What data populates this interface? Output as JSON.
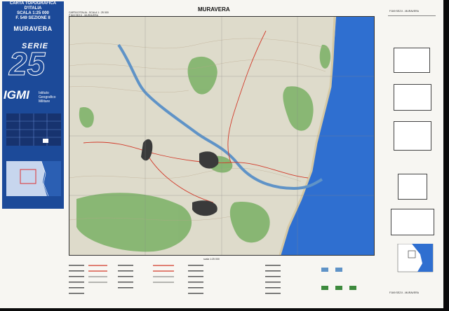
{
  "cover": {
    "title_line1": "CARTA TOPOGRAFICA D'ITALIA",
    "title_line2": "SCALA 1:25 000",
    "title_line3": "F. 549 SEZIONE II",
    "sheet_name": "MURAVERA",
    "serie_label": "SERIE",
    "serie_number": "25",
    "publisher_logo": "IGMI",
    "publisher_name": "Istituto Geografico Militare"
  },
  "map": {
    "title": "MURAVERA",
    "header_line1": "CARTA D'ITALIA - SCALA 1 : 25 000",
    "header_line2": "F.549 SEZ.II - MURAVERA",
    "scale_text": "scala 1:25 000",
    "colors": {
      "sea": "#2f6fd0",
      "forest": "#7fb36a",
      "terrain": "#d9d6c6",
      "roads": "#d23a2a",
      "river": "#5f93c7"
    }
  },
  "right_panel": {
    "top_label": "F.549 SEZ.II - MURAVERA",
    "bottom_label": "F.549 SEZ.II - MURAVERA"
  }
}
